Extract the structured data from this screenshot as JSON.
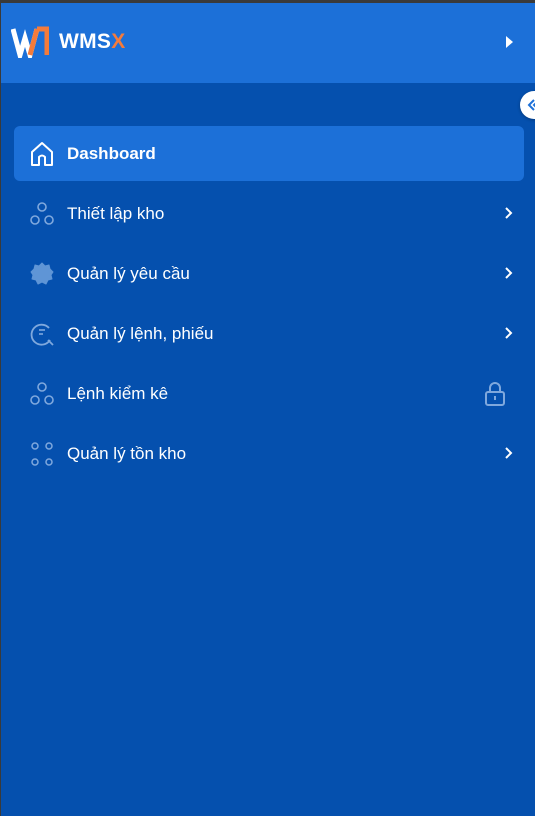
{
  "brand": {
    "name_main": "WMS",
    "name_accent": "X",
    "accent_color": "#f47b3b",
    "header_color": "#1c70d8",
    "sidebar_color": "#0550ae"
  },
  "menu": {
    "items": [
      {
        "label": "Dashboard",
        "icon": "home-icon",
        "active": true,
        "trailing": "none"
      },
      {
        "label": "Thiết lập kho",
        "icon": "dots-cluster-icon",
        "active": false,
        "trailing": "chevron-right-icon"
      },
      {
        "label": "Quản lý yêu cầu",
        "icon": "badge-icon",
        "active": false,
        "trailing": "chevron-right-icon"
      },
      {
        "label": "Quản lý lệnh, phiếu",
        "icon": "search-document-icon",
        "active": false,
        "trailing": "chevron-right-icon"
      },
      {
        "label": "Lệnh kiểm kê",
        "icon": "dots-cluster-icon",
        "active": false,
        "trailing": "lock-icon"
      },
      {
        "label": "Quản lý tồn kho",
        "icon": "dots-grid-icon",
        "active": false,
        "trailing": "chevron-right-icon"
      }
    ]
  }
}
